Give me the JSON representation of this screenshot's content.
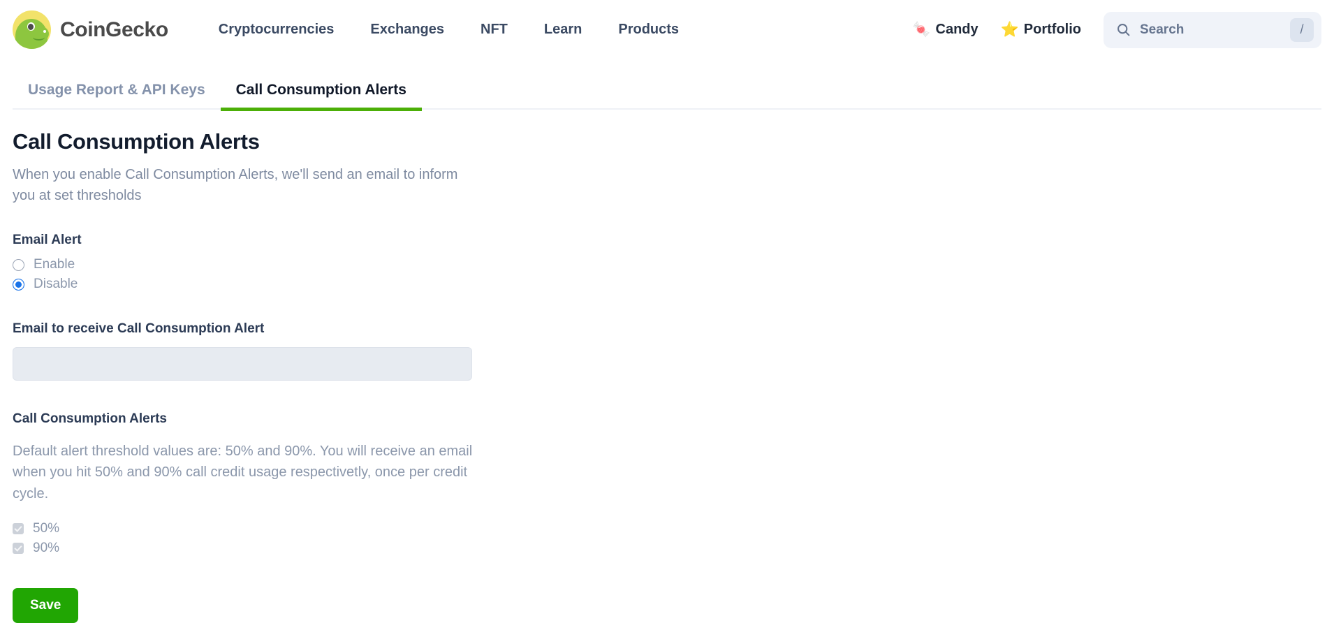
{
  "header": {
    "brand_name": "CoinGecko",
    "logo_icon": "gecko-logo-icon",
    "nav": [
      {
        "label": "Cryptocurrencies"
      },
      {
        "label": "Exchanges"
      },
      {
        "label": "NFT"
      },
      {
        "label": "Learn"
      },
      {
        "label": "Products"
      }
    ],
    "candy": {
      "label": "Candy",
      "icon": "candy-jar-icon",
      "glyph": "🍬"
    },
    "portfolio": {
      "label": "Portfolio",
      "icon": "star-icon",
      "glyph": "⭐"
    },
    "search": {
      "placeholder": "Search",
      "value": "",
      "icon": "search-icon",
      "shortcut_key": "/"
    }
  },
  "tabs": [
    {
      "label": "Usage Report & API Keys",
      "active": false
    },
    {
      "label": "Call Consumption Alerts",
      "active": true
    }
  ],
  "main": {
    "title": "Call Consumption Alerts",
    "description": "When you enable Call Consumption Alerts, we'll send an email to inform you at set thresholds",
    "email_alert": {
      "label": "Email Alert",
      "options": [
        {
          "label": "Enable",
          "selected": false
        },
        {
          "label": "Disable",
          "selected": true
        }
      ]
    },
    "email_field": {
      "label": "Email to receive Call Consumption Alert",
      "value": "",
      "placeholder": "",
      "disabled": true
    },
    "alerts_section": {
      "heading": "Call Consumption Alerts",
      "description": "Default alert threshold values are: 50% and 90%. You will receive an email when you hit 50% and 90% call credit usage respectivetly, once per credit cycle.",
      "thresholds": [
        {
          "label": "50%",
          "checked": true,
          "disabled": true
        },
        {
          "label": "90%",
          "checked": true,
          "disabled": true
        }
      ]
    },
    "save_label": "Save"
  },
  "colors": {
    "brand_green": "#4caf08",
    "save_green": "#21a603",
    "radio_blue": "#1a73e8",
    "text_dark": "#121c2d",
    "text_muted": "#8b97ab"
  }
}
